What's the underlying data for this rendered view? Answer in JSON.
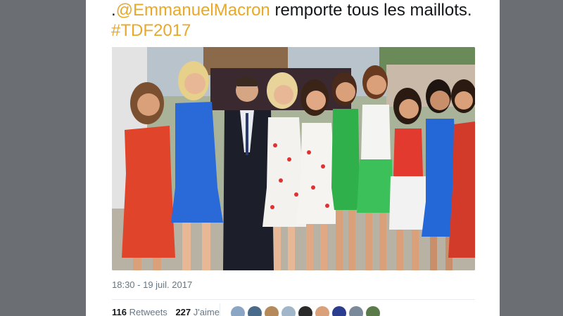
{
  "tweet": {
    "mention": "@EmmanuelMacron",
    "text_part1": " remporte tous les maillots. ",
    "hashtag": "#TDF2017",
    "prefix": "."
  },
  "meta": {
    "timestamp": "18:30 - 19 juil. 2017"
  },
  "stats": {
    "retweets_count": "116",
    "retweets_label": "Retweets",
    "likes_count": "227",
    "likes_label": "J'aime"
  },
  "avatars": [
    {
      "color": "#8aa6c4"
    },
    {
      "color": "#4a6a8a"
    },
    {
      "color": "#b58a5a"
    },
    {
      "color": "#a2b6c9"
    },
    {
      "color": "#2a2a2a"
    },
    {
      "color": "#d9a07a"
    },
    {
      "color": "#2a3d8f"
    },
    {
      "color": "#7a8a9a"
    },
    {
      "color": "#5a7a4a"
    }
  ],
  "colors": {
    "link": "#e8a92a",
    "text": "#14171a",
    "muted": "#657786",
    "background": "#6b6e72"
  }
}
